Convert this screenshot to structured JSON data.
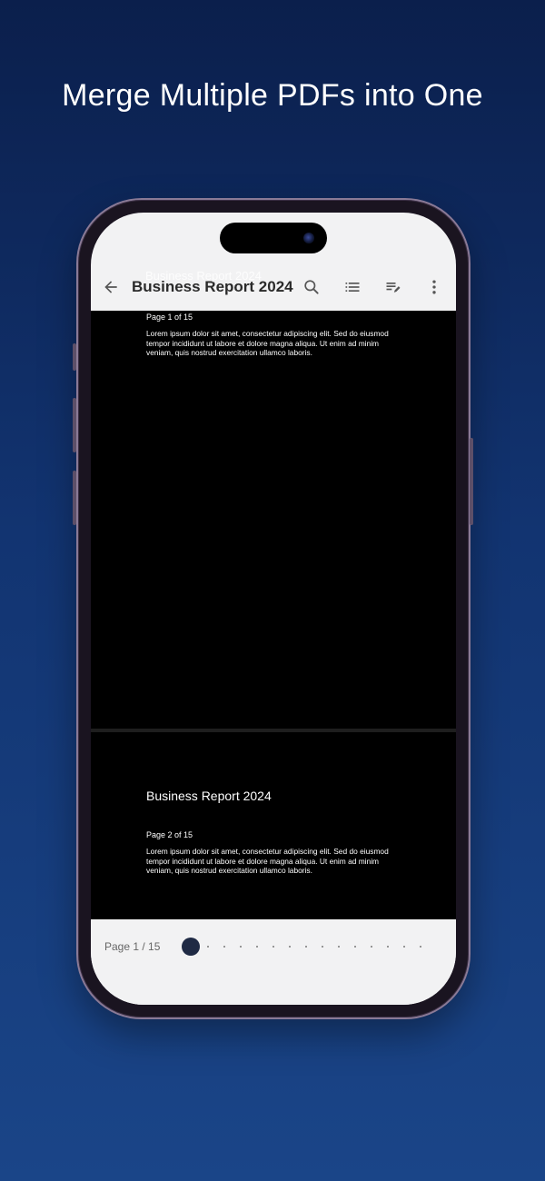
{
  "headline": "Merge Multiple PDFs into One",
  "app_bar": {
    "title": "Business Report 2024",
    "ghost_title": "Business Report 2024",
    "icons": [
      "back-arrow-icon",
      "search-icon",
      "list-icon",
      "edit-note-icon",
      "more-vert-icon"
    ]
  },
  "document": {
    "page1": {
      "page_label": "Page 1 of 15",
      "paragraph": "Lorem ipsum dolor sit amet, consectetur adipiscing elit. Sed do eiusmod tempor incididunt ut labore et dolore magna aliqua. Ut enim ad minim veniam, quis nostrud exercitation ullamco laboris."
    },
    "page2": {
      "title": "Business Report 2024",
      "page_label": "Page 2 of 15",
      "paragraph": "Lorem ipsum dolor sit amet, consectetur adipiscing elit. Sed do eiusmod tempor incididunt ut labore et dolore magna aliqua. Ut enim ad minim veniam, quis nostrud exercitation ullamco laboris."
    }
  },
  "bottom_bar": {
    "page_count": "Page 1 / 15",
    "current_page": 1,
    "total_pages": 15
  },
  "colors": {
    "background_top": "#0b1f4c",
    "background_bottom": "#1a4588",
    "thumb": "#1f2a44"
  }
}
